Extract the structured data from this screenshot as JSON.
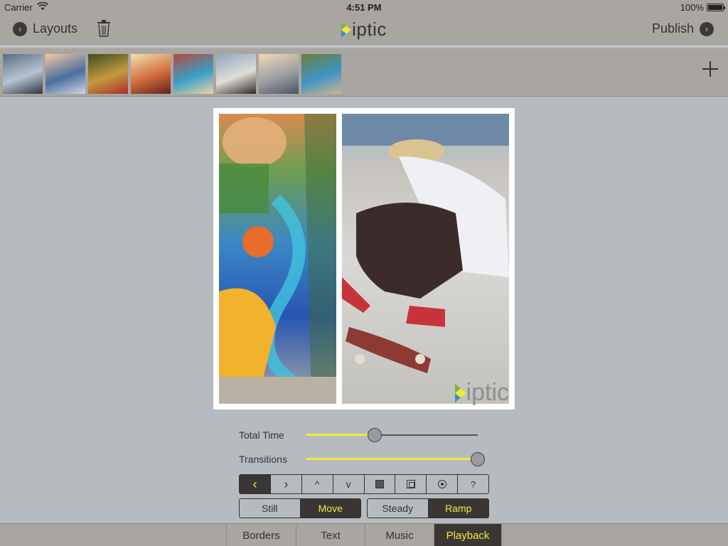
{
  "status_bar": {
    "carrier": "Carrier",
    "time": "4:51 PM",
    "battery": "100%"
  },
  "nav": {
    "back_label": "Layouts",
    "app_name": "iptic",
    "publish_label": "Publish",
    "icons": [
      "chevron-left-icon",
      "trash-icon",
      "diptic-logo",
      "chevron-right-icon"
    ]
  },
  "thumbnails": [
    {
      "name": "bridge",
      "colors": [
        "#5a6d88",
        "#b7c3cf",
        "#2d3642"
      ]
    },
    {
      "name": "sunglasses",
      "colors": [
        "#f3c9a4",
        "#4a6ea0",
        "#cfd8e2"
      ]
    },
    {
      "name": "fruit-basket",
      "colors": [
        "#3d4a22",
        "#c49a40",
        "#a8302a"
      ]
    },
    {
      "name": "drink-jar",
      "colors": [
        "#f1e2b4",
        "#d36b3a",
        "#5b2420"
      ]
    },
    {
      "name": "mural",
      "colors": [
        "#b4493e",
        "#39a0c8",
        "#ead6a4"
      ]
    },
    {
      "name": "skater-thumb",
      "colors": [
        "#8ea8be",
        "#e0ddd7",
        "#2d2a2a"
      ]
    },
    {
      "name": "ice-cream",
      "colors": [
        "#f3d9b5",
        "#9b9fa3",
        "#4d5360"
      ]
    },
    {
      "name": "plaza",
      "colors": [
        "#6c7f3a",
        "#3e94c4",
        "#c9b58d"
      ]
    }
  ],
  "add_photo_icon": "plus-icon",
  "watermark": "iptic",
  "controls": {
    "total_time_label": "Total Time",
    "total_time_value": 0.4,
    "transitions_label": "Transitions",
    "transitions_value": 1.0,
    "directions": [
      {
        "name": "left",
        "glyph": "‹",
        "active": true
      },
      {
        "name": "right",
        "glyph": "›",
        "active": false
      },
      {
        "name": "up",
        "glyph": "^",
        "active": false
      },
      {
        "name": "down",
        "glyph": "v",
        "active": false
      },
      {
        "name": "square",
        "glyph": "",
        "active": false
      },
      {
        "name": "frame",
        "glyph": "",
        "active": false
      },
      {
        "name": "target",
        "glyph": "",
        "active": false
      },
      {
        "name": "help",
        "glyph": "?",
        "active": false
      }
    ],
    "motion": {
      "still": "Still",
      "move": "Move",
      "selected": "Move"
    },
    "speed": {
      "steady": "Steady",
      "ramp": "Ramp",
      "selected": "Ramp"
    }
  },
  "tabs": [
    {
      "label": "Borders",
      "active": false
    },
    {
      "label": "Text",
      "active": false
    },
    {
      "label": "Music",
      "active": false
    },
    {
      "label": "Playback",
      "active": true
    }
  ],
  "colors": {
    "accent": "#f0ea3c",
    "bar_bg": "#a9a5a1",
    "canvas_bg": "#b6bbc0",
    "active_bg": "#3a3633"
  }
}
